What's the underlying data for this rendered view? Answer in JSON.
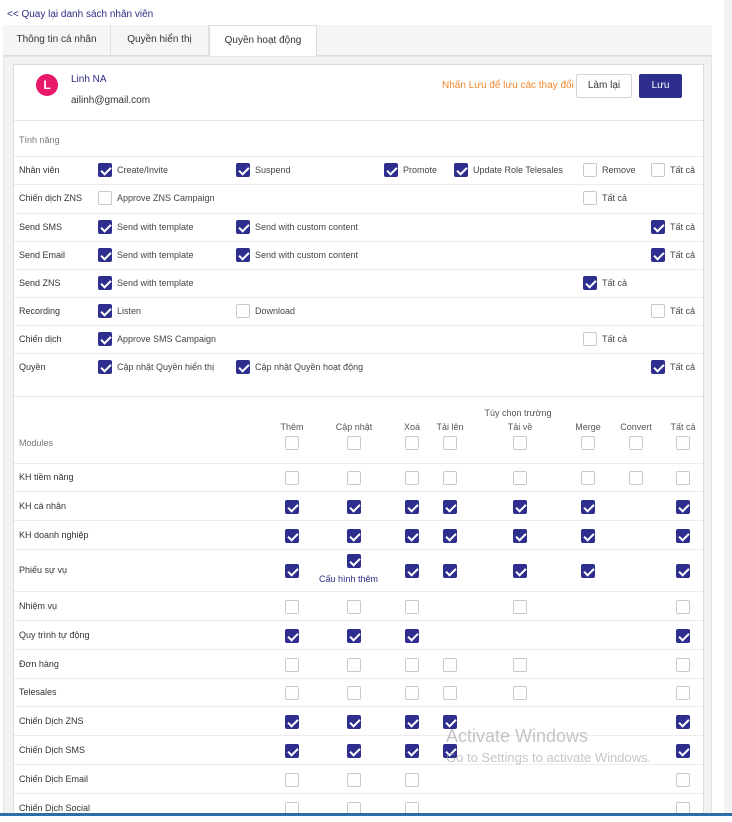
{
  "nav": {
    "back_label": "<< Quay lại danh sách nhân viên"
  },
  "tabs": [
    {
      "label": "Thông tin cá nhân"
    },
    {
      "label": "Quyền hiển thị"
    },
    {
      "label": "Quyền hoạt động"
    }
  ],
  "user": {
    "initial": "L",
    "name": "Linh NA",
    "email": "ailinh@gmail.com"
  },
  "header": {
    "hint": "Nhấn Lưu để lưu các thay đổi",
    "reset_label": "Làm lại",
    "save_label": "Lưu"
  },
  "colors": {
    "accent": "#2e2e8e",
    "avatar": "#e8196a",
    "hint": "#f0882e"
  },
  "features": {
    "section_label": "Tính năng",
    "all_label": "Tất cả",
    "rows": [
      {
        "label": "Nhân viên",
        "all": false,
        "options": [
          {
            "label": "Create/Invite",
            "checked": true
          },
          {
            "label": "Suspend",
            "checked": true
          },
          {
            "label": "Promote",
            "checked": true
          },
          {
            "label": "Update Role Telesales",
            "checked": true
          },
          {
            "label": "Remove",
            "checked": false
          }
        ]
      },
      {
        "label": "Chiến dịch ZNS",
        "all": false,
        "options": [
          {
            "label": "Approve ZNS Campaign",
            "checked": false
          }
        ]
      },
      {
        "label": "Send SMS",
        "all": true,
        "options": [
          {
            "label": "Send with template",
            "checked": true
          },
          {
            "label": "Send with custom content",
            "checked": true
          }
        ]
      },
      {
        "label": "Send Email",
        "all": true,
        "options": [
          {
            "label": "Send with template",
            "checked": true
          },
          {
            "label": "Send with custom content",
            "checked": true
          }
        ]
      },
      {
        "label": "Send ZNS",
        "all": true,
        "options": [
          {
            "label": "Send with template",
            "checked": true
          }
        ]
      },
      {
        "label": "Recording",
        "all": false,
        "options": [
          {
            "label": "Listen",
            "checked": true
          },
          {
            "label": "Download",
            "checked": false
          }
        ]
      },
      {
        "label": "Chiến dịch",
        "all": false,
        "options": [
          {
            "label": "Approve SMS Campaign",
            "checked": true
          }
        ]
      },
      {
        "label": "Quyền",
        "all": true,
        "options": [
          {
            "label": "Cập nhật Quyền hiển thị",
            "checked": true
          },
          {
            "label": "Cập nhật Quyền hoạt động",
            "checked": true
          }
        ]
      }
    ]
  },
  "modules": {
    "section_label": "Modules",
    "group_header": "Tùy chọn trường",
    "columns": [
      "Thêm",
      "Cập nhật",
      "Xoá",
      "Tải lên",
      "Tải về",
      "Merge",
      "Convert",
      "Tất cả"
    ],
    "update_note": "Cấu hình thêm",
    "rows": [
      {
        "label": "KH tiềm năng",
        "cells": [
          false,
          false,
          false,
          false,
          false,
          false,
          false,
          false
        ]
      },
      {
        "label": "KH cá nhân",
        "cells": [
          true,
          true,
          true,
          true,
          true,
          true,
          null,
          true
        ]
      },
      {
        "label": "KH doanh nghiệp",
        "cells": [
          true,
          true,
          true,
          true,
          true,
          true,
          null,
          true
        ]
      },
      {
        "label": "Phiếu sự vụ",
        "cells": [
          true,
          true,
          true,
          true,
          true,
          true,
          null,
          true
        ]
      },
      {
        "label": "Nhiệm vụ",
        "cells": [
          false,
          false,
          false,
          null,
          false,
          null,
          null,
          false
        ]
      },
      {
        "label": "Quy trình tự động",
        "cells": [
          true,
          true,
          true,
          null,
          null,
          null,
          null,
          true
        ]
      },
      {
        "label": "Đơn hàng",
        "cells": [
          false,
          false,
          false,
          false,
          false,
          null,
          null,
          false
        ]
      },
      {
        "label": "Telesales",
        "cells": [
          false,
          false,
          false,
          false,
          false,
          null,
          null,
          false
        ]
      },
      {
        "label": "Chiến Dịch ZNS",
        "cells": [
          true,
          true,
          true,
          true,
          null,
          null,
          null,
          true
        ]
      },
      {
        "label": "Chiến Dịch SMS",
        "cells": [
          true,
          true,
          true,
          true,
          null,
          null,
          null,
          true
        ]
      },
      {
        "label": "Chiến Dịch Email",
        "cells": [
          false,
          false,
          false,
          null,
          null,
          null,
          null,
          false
        ]
      },
      {
        "label": "Chiến Dịch Social",
        "cells": [
          false,
          false,
          false,
          null,
          null,
          null,
          null,
          false
        ]
      }
    ]
  },
  "watermark": {
    "line1": "Activate Windows",
    "line2": "Go to Settings to activate Windows."
  }
}
